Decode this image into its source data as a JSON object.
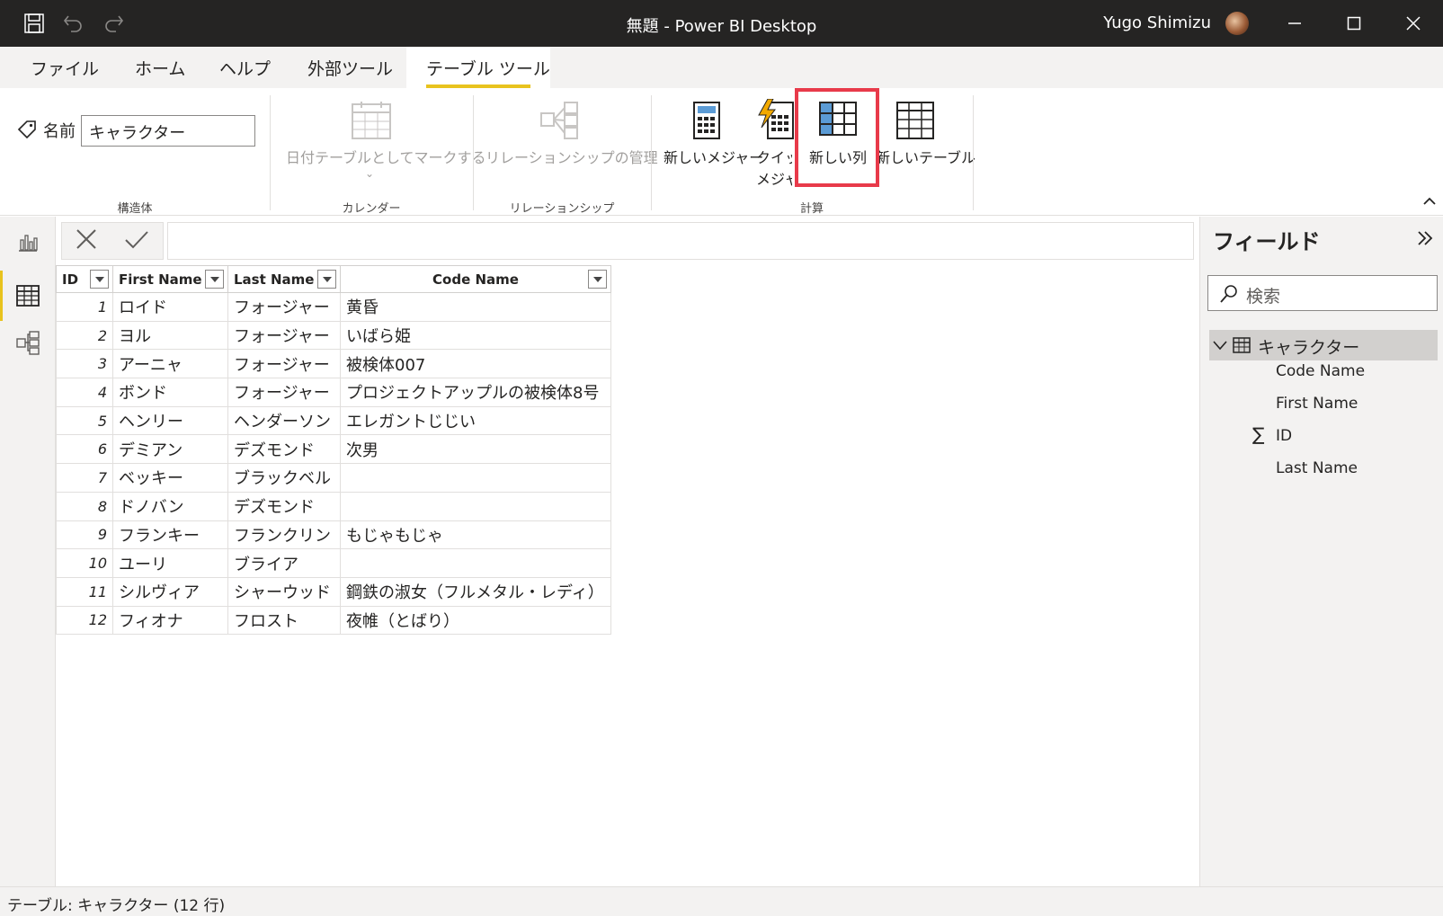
{
  "window": {
    "title": "無題 - Power BI Desktop",
    "user": "Yugo Shimizu"
  },
  "tabs": [
    {
      "label": "ファイル"
    },
    {
      "label": "ホーム"
    },
    {
      "label": "ヘルプ"
    },
    {
      "label": "外部ツール"
    },
    {
      "label": "テーブル ツール",
      "active": true
    }
  ],
  "ribbon": {
    "structure": {
      "name_label": "名前",
      "name_value": "キャラクター",
      "group": "構造体"
    },
    "calendar": {
      "button": "日付テーブルとしてマークする",
      "group": "カレンダー"
    },
    "relationship": {
      "button": "リレーションシップの管理",
      "group": "リレーションシップ"
    },
    "calc": {
      "new_measure": "新しいメジャー",
      "quick_measure_1": "クイック",
      "quick_measure_2": "メジャー",
      "new_column": "新しい列",
      "new_table": "新しいテーブル",
      "group": "計算"
    }
  },
  "table": {
    "columns": [
      "ID",
      "First Name",
      "Last Name",
      "Code Name"
    ],
    "rows": [
      {
        "id": "1",
        "first": "ロイド",
        "last": "フォージャー",
        "code": "黄昏"
      },
      {
        "id": "2",
        "first": "ヨル",
        "last": "フォージャー",
        "code": "いばら姫"
      },
      {
        "id": "3",
        "first": "アーニャ",
        "last": "フォージャー",
        "code": "被検体007"
      },
      {
        "id": "4",
        "first": "ボンド",
        "last": "フォージャー",
        "code": "プロジェクトアップルの被検体8号"
      },
      {
        "id": "5",
        "first": "ヘンリー",
        "last": "ヘンダーソン",
        "code": "エレガントじじい"
      },
      {
        "id": "6",
        "first": "デミアン",
        "last": "デズモンド",
        "code": "次男"
      },
      {
        "id": "7",
        "first": "ベッキー",
        "last": "ブラックベル",
        "code": ""
      },
      {
        "id": "8",
        "first": "ドノバン",
        "last": "デズモンド",
        "code": ""
      },
      {
        "id": "9",
        "first": "フランキー",
        "last": "フランクリン",
        "code": "もじゃもじゃ"
      },
      {
        "id": "10",
        "first": "ユーリ",
        "last": "ブライア",
        "code": ""
      },
      {
        "id": "11",
        "first": "シルヴィア",
        "last": "シャーウッド",
        "code": "鋼鉄の淑女（フルメタル・レディ）"
      },
      {
        "id": "12",
        "first": "フィオナ",
        "last": "フロスト",
        "code": "夜帷（とばり）"
      }
    ]
  },
  "fields_pane": {
    "title": "フィールド",
    "search_placeholder": "検索",
    "table_name": "キャラクター",
    "fields": [
      "Code Name",
      "First Name",
      "ID",
      "Last Name"
    ]
  },
  "status": "テーブル: キャラクター (12 行)",
  "colors": {
    "titlebar": "#252423",
    "accent": "#e8c31e",
    "highlight": "#e83a4a"
  }
}
